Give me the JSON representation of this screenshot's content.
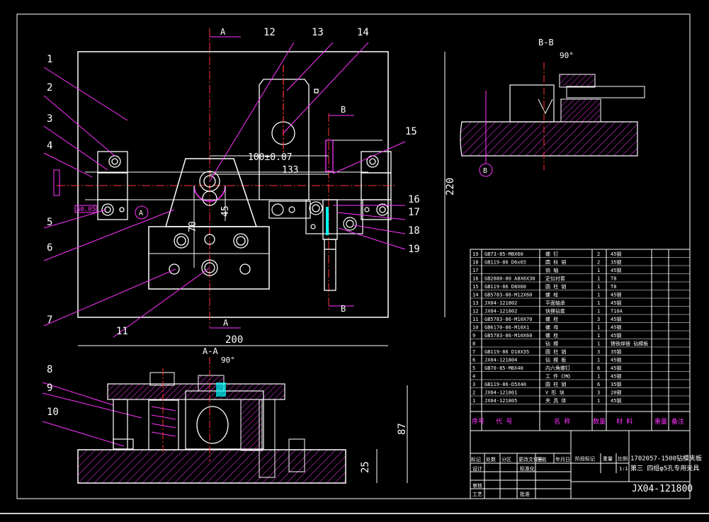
{
  "section_labels": {
    "a_top": "A",
    "a_bottom": "A",
    "b_top": "B",
    "b_bottom": "B",
    "bb_title": "B-B",
    "bb_angle": "90°",
    "bb_marker": "B",
    "aa_title": "A-A",
    "aa_angle": "90°",
    "a_marker": "A"
  },
  "dimensions": {
    "d100": "100±0.07",
    "d133": "133",
    "d45": "45",
    "d70": "70",
    "d220": "220",
    "d200": "200",
    "d87": "87",
    "d25": "25"
  },
  "part_numbers": [
    "1",
    "2",
    "3",
    "4",
    "5",
    "6",
    "7",
    "8",
    "9",
    "10",
    "11",
    "12",
    "13",
    "14",
    "15",
    "16",
    "17",
    "18",
    "19"
  ],
  "bom": {
    "rows": [
      {
        "no": "19",
        "code": "GB73-85-M8X60",
        "name": "螺 钉",
        "qty": "2",
        "mat": "45钢"
      },
      {
        "no": "18",
        "code": "GB119-86 D6x65",
        "name": "圆 柱 销",
        "qty": "2",
        "mat": "35钢"
      },
      {
        "no": "17",
        "code": "",
        "name": "销 轴",
        "qty": "1",
        "mat": "45钢"
      },
      {
        "no": "16",
        "code": "GB2880-80 A8X6X30",
        "name": "定位衬套",
        "qty": "1",
        "mat": "T8"
      },
      {
        "no": "15",
        "code": "GB119-86 D8X60",
        "name": "圆 柱 销",
        "qty": "1",
        "mat": "T8"
      },
      {
        "no": "14",
        "code": "GB5783-86-M12X60",
        "name": "螺 栓",
        "qty": "1",
        "mat": "45钢"
      },
      {
        "no": "13",
        "code": "JX04-121802",
        "name": "平面轴承",
        "qty": "1",
        "mat": "45钢"
      },
      {
        "no": "12",
        "code": "JX04-121802",
        "name": "快换钻套",
        "qty": "1",
        "mat": "T10A"
      },
      {
        "no": "11",
        "code": "GB5783-86-M10X70",
        "name": "螺 栓",
        "qty": "3",
        "mat": "45钢"
      },
      {
        "no": "10",
        "code": "GB6170-86-M10X1",
        "name": "螺 母",
        "qty": "1",
        "mat": "45钢"
      },
      {
        "no": "9",
        "code": "GB5783-86-M10X60",
        "name": "螺 栓",
        "qty": "1",
        "mat": "45钢"
      },
      {
        "no": "8",
        "code": "",
        "name": "钻 模",
        "qty": "1",
        "mat": "铸铁焊接 钻模板"
      },
      {
        "no": "7",
        "code": "GB119-86 D10X35",
        "name": "圆 柱 销",
        "qty": "3",
        "mat": "35钢"
      },
      {
        "no": "6",
        "code": "JX04-121804",
        "name": "钻 模 板",
        "qty": "1",
        "mat": "45钢"
      },
      {
        "no": "5",
        "code": "GB70-85-M8X40",
        "name": "内六角螺钉",
        "qty": "6",
        "mat": "45钢"
      },
      {
        "no": "4",
        "code": "",
        "name": "工 件 CMO",
        "qty": "1",
        "mat": "45钢"
      },
      {
        "no": "3",
        "code": "GB119-86-D5X40",
        "name": "圆 柱 销",
        "qty": "6",
        "mat": "35钢"
      },
      {
        "no": "2",
        "code": "JX04-121801",
        "name": "V 形 块",
        "qty": "3",
        "mat": "20钢"
      },
      {
        "no": "1",
        "code": "JX04-121805",
        "name": "夹 具 体",
        "qty": "1",
        "mat": "45钢"
      }
    ],
    "headers": {
      "no": "序号",
      "code": "代 号",
      "name": "名 称",
      "qty": "数量",
      "mat": "材 料",
      "unit_w": "重量",
      "note": "备注"
    }
  },
  "title_block": {
    "labels": [
      "标记",
      "处数",
      "分区",
      "更改文件号",
      "签名",
      "年月日"
    ],
    "roles": [
      "设计",
      "标准化",
      "审核",
      "工艺",
      "批准"
    ],
    "stage_label": "阶段标记",
    "weight_label": "重量",
    "scale_label": "比例",
    "scale_value": "1:1",
    "title_line1": "1702057-1500钻模夹板",
    "title_line2": "第三 四组φ5孔专用夹具",
    "drawing_no": "JX04-121800"
  }
}
